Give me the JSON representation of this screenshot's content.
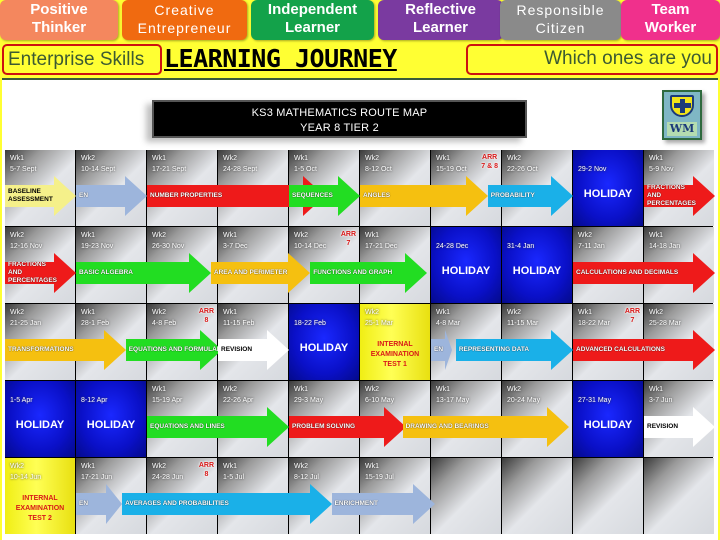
{
  "skills": [
    {
      "label": "Positive Thinker",
      "line1": "Positive",
      "line2": "Thinker",
      "color": "#f4875e"
    },
    {
      "label": "Creative Entrepreneur",
      "line1": "Creative",
      "line2": "Entrepreneur",
      "color": "#f06a10"
    },
    {
      "label": "Independent Learner",
      "line1": "Independent",
      "line2": "Learner",
      "color": "#13a24a"
    },
    {
      "label": "Reflective Learner",
      "line1": "Reflective",
      "line2": "Learner",
      "color": "#7a3aa0"
    },
    {
      "label": "Responsible Citizen",
      "line1": "Responsible",
      "line2": "Citizen",
      "color": "#8a8a8a"
    },
    {
      "label": "Team Worker",
      "line1": "Team",
      "line2": "Worker",
      "color": "#f0308c"
    }
  ],
  "enterprise_label": "Enterprise Skills",
  "journey_title": "LEARNING JOURNEY",
  "which_label": "Which ones are you",
  "banner": {
    "line1": "KS3 MATHEMATICS  ROUTE MAP",
    "line2": "YEAR 8    TIER 2"
  },
  "logo": {
    "text": "WM"
  },
  "rows": [
    {
      "cells": [
        {
          "week": "Wk1",
          "dates": "5-7 Sept"
        },
        {
          "week": "Wk2",
          "dates": "10-14 Sept"
        },
        {
          "week": "Wk1",
          "dates": "17-21 Sept"
        },
        {
          "week": "Wk2",
          "dates": "24-28 Sept"
        },
        {
          "week": "Wk1",
          "dates": "1-5 Oct"
        },
        {
          "week": "Wk2",
          "dates": "8-12 Oct"
        },
        {
          "week": "Wk1",
          "dates": "15-19 Oct",
          "arr": "ARR",
          "arr_sub": "7 & 8"
        },
        {
          "week": "Wk2",
          "dates": "22-26 Oct"
        },
        {
          "week": "",
          "dates": "29-2 Nov",
          "holiday": "HOLIDAY"
        },
        {
          "week": "Wk1",
          "dates": "5-9 Nov"
        }
      ],
      "topics": [
        {
          "label": "BASELINE ASSESSMENT",
          "start": 0,
          "span": 1,
          "color": "#f5f08a",
          "dark": true
        },
        {
          "label": "EN",
          "start": 1,
          "span": 1,
          "color": "#9db5dc"
        },
        {
          "label": "NUMBER PROPERTIES",
          "start": 2,
          "span": 2.5,
          "color": "#ee1a1a"
        },
        {
          "label": "SEQUENCES",
          "start": 4,
          "span": 1,
          "color": "#22dd22"
        },
        {
          "label": "ANGLES",
          "start": 5,
          "span": 1.8,
          "color": "#f5c010"
        },
        {
          "label": "PROBABILITY",
          "start": 6.8,
          "span": 1.2,
          "color": "#1ab0e8"
        },
        {
          "label": "FRACTIONS AND PERCENTAGES",
          "start": 9,
          "span": 1,
          "color": "#ee1a1a"
        }
      ]
    },
    {
      "cells": [
        {
          "week": "Wk2",
          "dates": "12-16 Nov"
        },
        {
          "week": "Wk1",
          "dates": "19-23 Nov"
        },
        {
          "week": "Wk2",
          "dates": "26-30 Nov"
        },
        {
          "week": "Wk1",
          "dates": "3-7 Dec"
        },
        {
          "week": "Wk2",
          "dates": "10-14 Dec",
          "arr": "ARR",
          "arr_sub": "7"
        },
        {
          "week": "Wk1",
          "dates": "17-21 Dec"
        },
        {
          "week": "",
          "dates": "24-28 Dec",
          "holiday": "HOLIDAY"
        },
        {
          "week": "",
          "dates": "31-4 Jan",
          "holiday": "HOLIDAY"
        },
        {
          "week": "Wk2",
          "dates": "7-11 Jan"
        },
        {
          "week": "Wk1",
          "dates": "14-18 Jan"
        }
      ],
      "topics": [
        {
          "label": "FRACTIONS AND PERCENTAGES",
          "start": 0,
          "span": 1,
          "color": "#ee1a1a"
        },
        {
          "label": "BASIC ALGEBRA",
          "start": 1,
          "span": 1.9,
          "color": "#22dd22"
        },
        {
          "label": "AREA AND PERIMETER",
          "start": 2.9,
          "span": 1.4,
          "color": "#f5c010"
        },
        {
          "label": "FUNCTIONS AND GRAPH",
          "start": 4.3,
          "span": 1.65,
          "color": "#22dd22"
        },
        {
          "label": "CALCULATIONS AND DECIMALS",
          "start": 8,
          "span": 2,
          "color": "#ee1a1a"
        }
      ]
    },
    {
      "cells": [
        {
          "week": "Wk2",
          "dates": "21-25 Jan"
        },
        {
          "week": "Wk1",
          "dates": "28-1 Feb"
        },
        {
          "week": "Wk2",
          "dates": "4-8 Feb",
          "arr": "ARR",
          "arr_sub": "8"
        },
        {
          "week": "Wk1",
          "dates": "11-15 Feb"
        },
        {
          "week": "",
          "dates": "18-22 Feb",
          "holiday": "HOLIDAY"
        },
        {
          "week": "Wk2",
          "dates": "25-1 Mar",
          "exam": [
            "INTERNAL",
            "EXAMINATION",
            "TEST 1"
          ]
        },
        {
          "week": "Wk1",
          "dates": "4-8 Mar"
        },
        {
          "week": "Wk2",
          "dates": "11-15 Mar"
        },
        {
          "week": "Wk1",
          "dates": "18-22 Mar",
          "arr": "ARR",
          "arr_sub": "7"
        },
        {
          "week": "Wk2",
          "dates": "25-28 Mar"
        }
      ],
      "topics": [
        {
          "label": "TRANSFORMATIONS",
          "start": 0,
          "span": 1.7,
          "color": "#f5c010"
        },
        {
          "label": "EQUATIONS AND FORMULAE",
          "start": 1.7,
          "span": 1.35,
          "color": "#22dd22"
        },
        {
          "label": "REVISION",
          "start": 3,
          "span": 1,
          "color": "#ffffff",
          "dark": true
        },
        {
          "label": "EN",
          "start": 6,
          "span": 0.3,
          "color": "#9db5dc"
        },
        {
          "label": "REPRESENTING DATA",
          "start": 6.35,
          "span": 1.65,
          "color": "#1ab0e8"
        },
        {
          "label": "ADVANCED CALCULATIONS",
          "start": 8,
          "span": 2,
          "color": "#ee1a1a"
        }
      ]
    },
    {
      "cells": [
        {
          "week": "",
          "dates": "1-5 Apr",
          "holiday": "HOLIDAY"
        },
        {
          "week": "",
          "dates": "8-12 Apr",
          "holiday": "HOLIDAY"
        },
        {
          "week": "Wk1",
          "dates": "15-19 Apr"
        },
        {
          "week": "Wk2",
          "dates": "22-26 Apr"
        },
        {
          "week": "Wk1",
          "dates": "29-3 May"
        },
        {
          "week": "Wk2",
          "dates": "6-10 May"
        },
        {
          "week": "Wk1",
          "dates": "13-17 May"
        },
        {
          "week": "Wk2",
          "dates": "20-24 May"
        },
        {
          "week": "",
          "dates": "27-31 May",
          "holiday": "HOLIDAY"
        },
        {
          "week": "Wk1",
          "dates": "3-7 Jun"
        }
      ],
      "topics": [
        {
          "label": "EQUATIONS AND LINES",
          "start": 2,
          "span": 2,
          "color": "#22dd22"
        },
        {
          "label": "PROBLEM SOLVING",
          "start": 4,
          "span": 1.65,
          "color": "#ee1a1a"
        },
        {
          "label": "DRAWING AND BEARINGS",
          "start": 5.6,
          "span": 2.35,
          "color": "#f5c010"
        },
        {
          "label": "REVISION",
          "start": 9,
          "span": 1,
          "color": "#ffffff",
          "dark": true
        }
      ]
    },
    {
      "cells": [
        {
          "week": "Wk2",
          "dates": "10-14 Jun",
          "exam": [
            "INTERNAL",
            "EXAMINATION",
            "TEST 2"
          ]
        },
        {
          "week": "Wk1",
          "dates": "17-21 Jun"
        },
        {
          "week": "Wk2",
          "dates": "24-28 Jun",
          "arr": "ARR",
          "arr_sub": "8"
        },
        {
          "week": "Wk1",
          "dates": "1-5 Jul"
        },
        {
          "week": "Wk2",
          "dates": "8-12 Jul"
        },
        {
          "week": "Wk1",
          "dates": "15-19 Jul"
        },
        {
          "week": "",
          "dates": ""
        },
        {
          "week": "",
          "dates": ""
        },
        {
          "week": "",
          "dates": ""
        },
        {
          "week": "",
          "dates": ""
        }
      ],
      "topics": [
        {
          "label": "EN",
          "start": 1,
          "span": 0.65,
          "color": "#9db5dc"
        },
        {
          "label": "AVERAGES AND PROBABILITIES",
          "start": 1.65,
          "span": 2.95,
          "color": "#1ab0e8"
        },
        {
          "label": "ENRICHMENT",
          "start": 4.6,
          "span": 1.45,
          "color": "#9db5dc"
        }
      ]
    }
  ]
}
